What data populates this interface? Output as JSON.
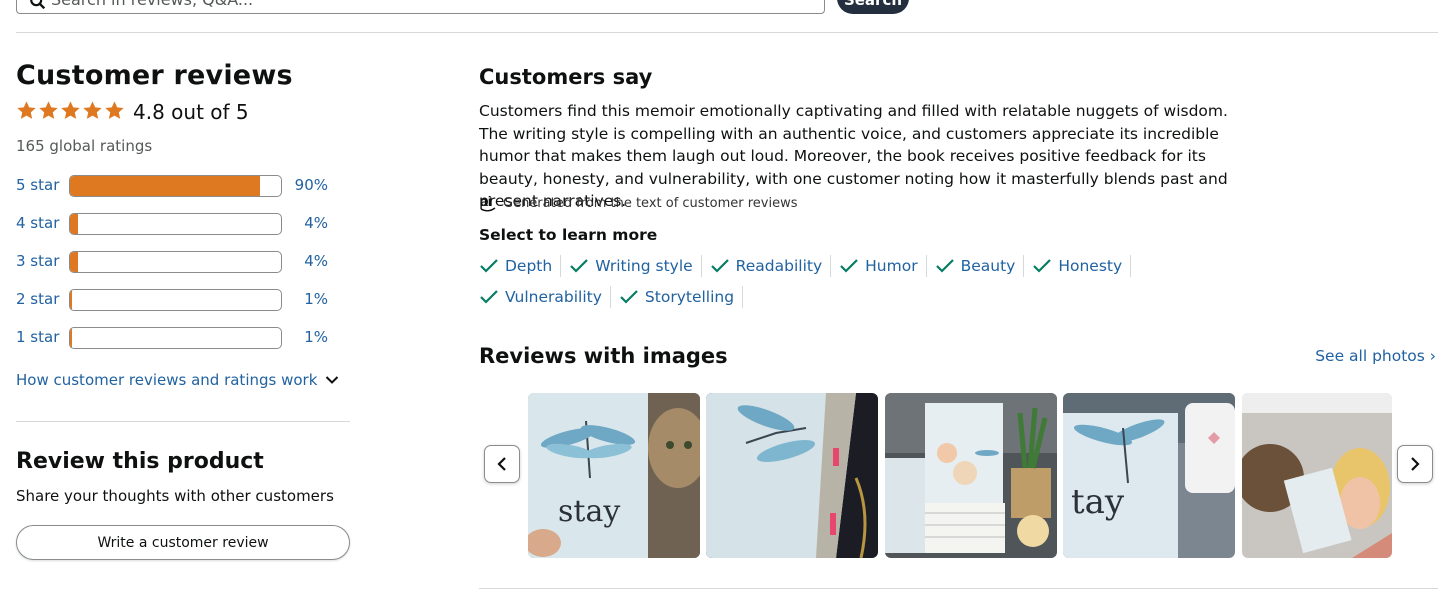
{
  "search": {
    "placeholder": "Search in reviews, Q&A...",
    "button_label": "Search"
  },
  "ratings": {
    "title": "Customer reviews",
    "stars_value": 4.8,
    "average_text": "4.8 out of 5",
    "global_text": "165 global ratings",
    "histogram": [
      {
        "label": "5 star",
        "percent_text": "90%",
        "percent": 90
      },
      {
        "label": "4 star",
        "percent_text": "4%",
        "percent": 4
      },
      {
        "label": "3 star",
        "percent_text": "4%",
        "percent": 4
      },
      {
        "label": "2 star",
        "percent_text": "1%",
        "percent": 1
      },
      {
        "label": "1 star",
        "percent_text": "1%",
        "percent": 1
      }
    ],
    "how_link": "How customer reviews and ratings work"
  },
  "review_product": {
    "title": "Review this product",
    "subtitle": "Share your thoughts with other customers",
    "button_label": "Write a customer review"
  },
  "customers_say": {
    "title": "Customers say",
    "summary": "Customers find this memoir emotionally captivating and filled with relatable nuggets of wisdom. The writing style is compelling with an authentic voice, and customers appreciate its incredible humor that makes them laugh out loud. Moreover, the book receives positive feedback for its beauty, honesty, and vulnerability, with one customer noting how it masterfully blends past and present narratives.",
    "ai_badge": "ai",
    "ai_note": "Generated from the text of customer reviews",
    "select_title": "Select to learn more",
    "aspects_row1": [
      "Depth",
      "Writing style",
      "Readability",
      "Humor",
      "Beauty",
      "Honesty"
    ],
    "aspects_row2": [
      "Vulnerability",
      "Storytelling"
    ]
  },
  "reviews_with_images": {
    "title": "Reviews with images",
    "see_all": "See all photos",
    "thumbnails": [
      {
        "alt": "Book 'stay' held up beside a cat"
      },
      {
        "alt": "Book 'stay' on a table with pink tab"
      },
      {
        "alt": "Stack of 'Stay' books at a display"
      },
      {
        "alt": "Book 'stay' next to a white mug"
      },
      {
        "alt": "Woman holding book 'stay'"
      }
    ]
  },
  "colors": {
    "accent_orange": "#de7921",
    "link_blue": "#2162a1",
    "check_green": "#067d62",
    "dark_button": "#232f3e"
  }
}
